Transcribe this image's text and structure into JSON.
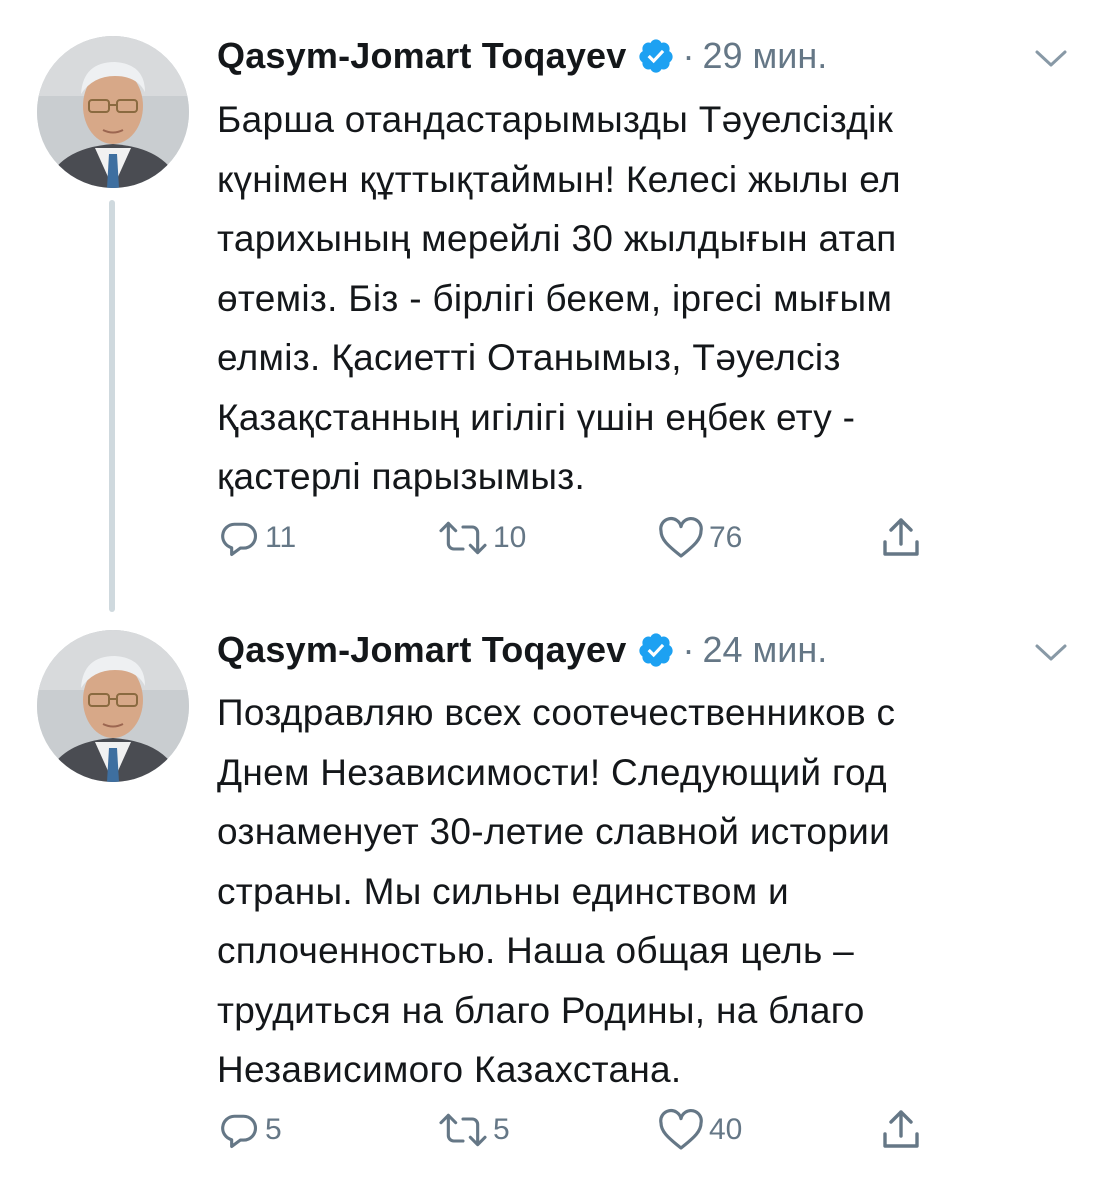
{
  "colors": {
    "text": "#14171a",
    "secondary": "#657786",
    "verified": "#1da1f2",
    "thread_line": "#cfd9de"
  },
  "tweets": [
    {
      "author": "Qasym-Jomart Toqayev",
      "verified_icon": "verified-badge-icon",
      "separator": "·",
      "time": "29 мин.",
      "text": "Барша отандастарымызды Тәуелсіздік\nкүнімен құттықтаймын! Келесі жылы ел\nтарихының мерейлі 30 жылдығын атап\nөтеміз. Біз - бірлігі бекем, іргесі мығым\nелміз. Қасиетті Отанымыз, Тәуелсіз\nҚазақстанның игілігі үшін еңбек ету -\nқастерлі парызымыз.",
      "replies": "11",
      "retweets": "10",
      "likes": "76"
    },
    {
      "author": "Qasym-Jomart Toqayev",
      "verified_icon": "verified-badge-icon",
      "separator": "·",
      "time": "24 мин.",
      "text": "Поздравляю всех соотечественников с\nДнем Независимости! Следующий год\nознаменует 30-летие славной истории\nстраны. Мы сильны единством и\nсплоченностью. Наша общая цель –\nтрудиться на благо Родины, на благо\nНезависимого Казахстана.",
      "replies": "5",
      "retweets": "5",
      "likes": "40"
    }
  ]
}
